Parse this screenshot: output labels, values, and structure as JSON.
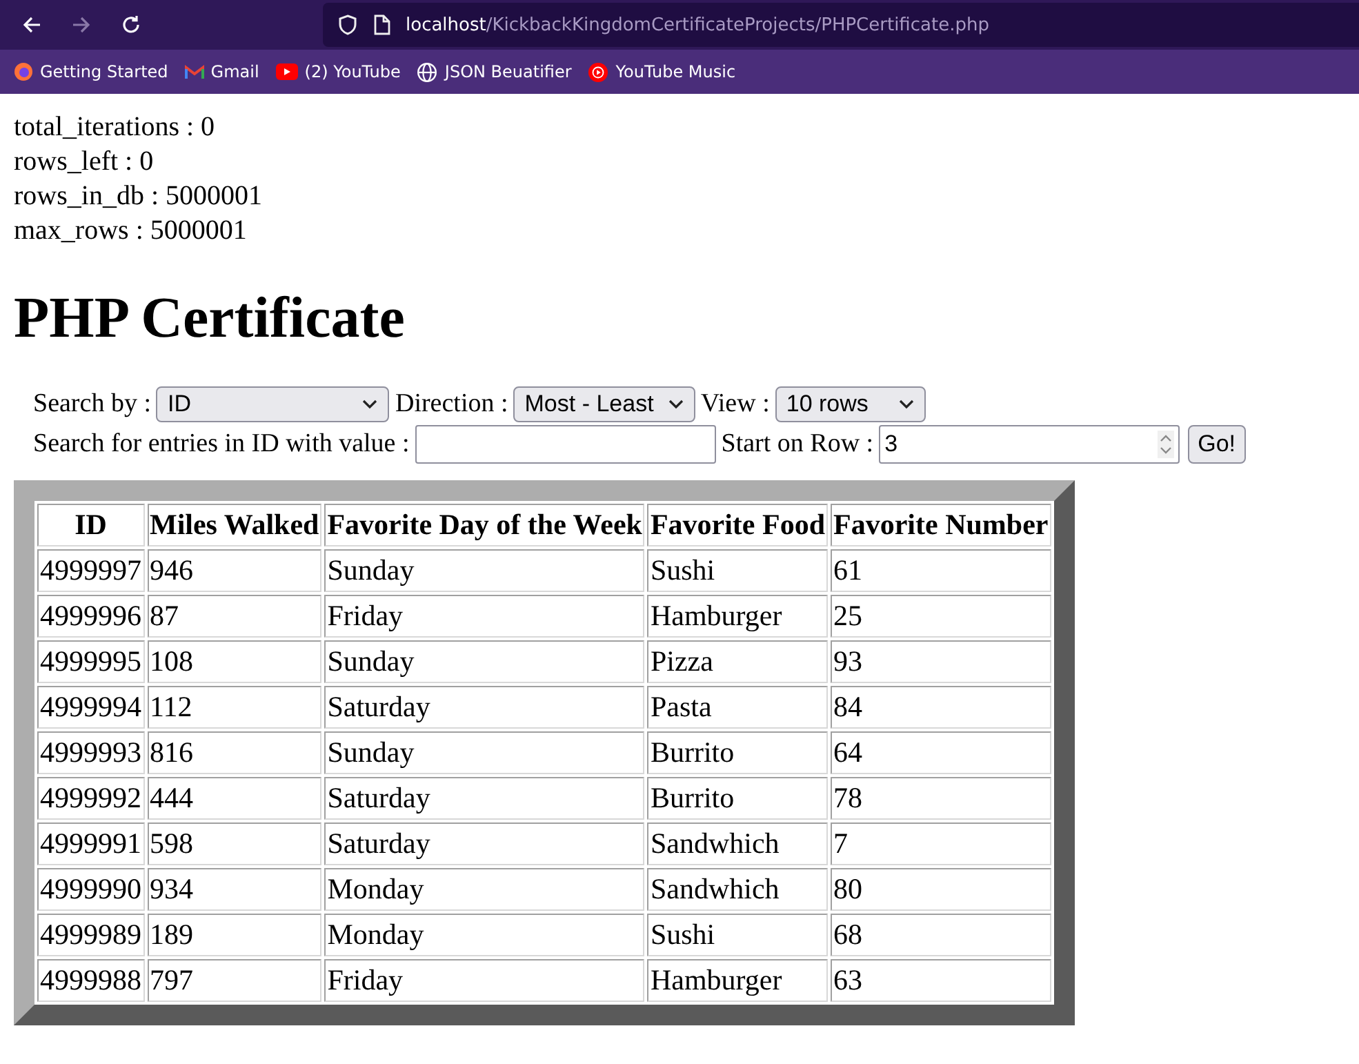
{
  "browser": {
    "nav": [
      {
        "kind": "back",
        "disabled": false
      },
      {
        "kind": "forward",
        "disabled": true
      },
      {
        "kind": "reload",
        "disabled": false
      }
    ],
    "url": {
      "host": "localhost",
      "path": "/KickbackKingdomCertificateProjects/PHPCertificate.php"
    },
    "bookmarks": [
      {
        "kind": "firefox",
        "label": "Getting Started"
      },
      {
        "kind": "gmail",
        "label": "Gmail"
      },
      {
        "kind": "youtube",
        "label": "(2) YouTube"
      },
      {
        "kind": "globe",
        "label": "JSON Beuatifier"
      },
      {
        "kind": "music",
        "label": "YouTube Music"
      }
    ]
  },
  "stats": [
    "total_iterations : 0",
    "rows_left : 0",
    "rows_in_db : 5000001",
    "max_rows : 5000001"
  ],
  "heading": "PHP Certificate",
  "form": {
    "search_by_label": "Search by :",
    "search_by": "ID",
    "direction_label": "Direction :",
    "direction": "Most - Least",
    "view_label": "View :",
    "view": "10 rows",
    "value_label": "Search for entries in ID with value :",
    "start_label": "Start on Row :",
    "start_row": "3",
    "go": "Go!"
  },
  "table": {
    "columns": [
      "ID",
      "Miles Walked",
      "Favorite Day of the Week",
      "Favorite Food",
      "Favorite Number"
    ],
    "rows": [
      [
        "4999997",
        "946",
        "Sunday",
        "Sushi",
        "61"
      ],
      [
        "4999996",
        "87",
        "Friday",
        "Hamburger",
        "25"
      ],
      [
        "4999995",
        "108",
        "Sunday",
        "Pizza",
        "93"
      ],
      [
        "4999994",
        "112",
        "Saturday",
        "Pasta",
        "84"
      ],
      [
        "4999993",
        "816",
        "Sunday",
        "Burrito",
        "64"
      ],
      [
        "4999992",
        "444",
        "Saturday",
        "Burrito",
        "78"
      ],
      [
        "4999991",
        "598",
        "Saturday",
        "Sandwhich",
        "7"
      ],
      [
        "4999990",
        "934",
        "Monday",
        "Sandwhich",
        "80"
      ],
      [
        "4999989",
        "189",
        "Monday",
        "Sushi",
        "68"
      ],
      [
        "4999988",
        "797",
        "Friday",
        "Hamburger",
        "63"
      ]
    ]
  }
}
